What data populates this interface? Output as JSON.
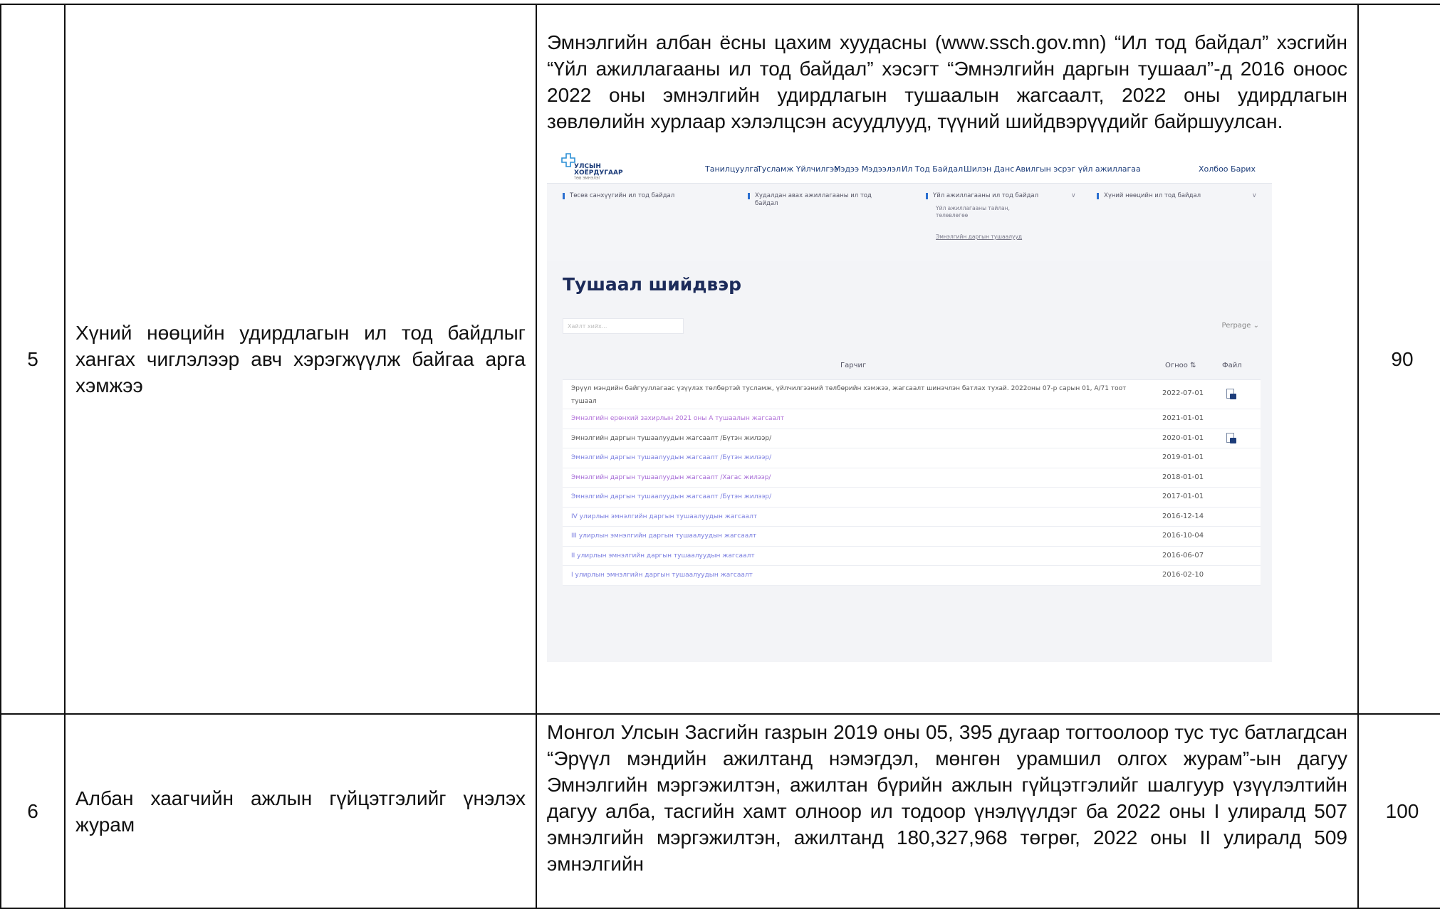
{
  "rows": [
    {
      "num": "5",
      "title": "Хүний нөөцийн удирдлагын ил тод байдлыг хангах чиглэлээр авч хэрэгжүүлж байгаа арга хэмжээ",
      "description": "Эмнэлгийн албан ёсны цахим хуудасны (www.ssch.gov.mn) “Ил тод байдал” хэсгийн “Үйл ажиллагааны ил тод байдал” хэсэгт “Эмнэлгийн даргын тушаал”-д 2016 оноос 2022 оны эмнэлгийн удирдлагын тушаалын жагсаалт, 2022 оны удирдлагын зөвлөлийн хурлаар хэлэлцсэн асуудлууд, түүний шийдвэрүүдийг байршуулсан.",
      "score": "90"
    },
    {
      "num": "6",
      "title": "Албан хаагчийн ажлын гүйцэтгэлийг үнэлэх журам",
      "description": "Монгол Улсын Засгийн газрын 2019 оны 05, 395 дугаар тогтоолоор тус тус батлагдсан “Эрүүл мэндийн ажилтанд нэмэгдэл, мөнгөн урамшил олгох журам”-ын дагуу Эмнэлгийн мэргэжилтэн, ажилтан бүрийн ажлын гүйцэтгэлийг шалгуур үзүүлэлтийн дагуу алба, тасгийн хамт олноор ил тодоор үнэлүүлдэг ба 2022 оны I улиралд 507 эмнэлгийн мэргэжилтэн, ажилтанд 180,327,968 төгрөг, 2022 оны II улиралд 509 эмнэлгийн",
      "score": "100"
    }
  ],
  "screenshot": {
    "logo": {
      "line1": "УЛСЫН",
      "line2": "ХОЁРДУГААР",
      "line3": "ТӨВ ЭМНЭЛЭГ"
    },
    "nav": [
      "Танилцуулга",
      "Тусламж Үйлчилгээ",
      "Мэдээ Мэдээлэл",
      "Ил Тод Байдал",
      "Шилэн Данс",
      "Авилгын эсрэг үйл ажиллагаа",
      "Холбоо Барих"
    ],
    "subnav": {
      "item1": "Төсөв санхүүгийн ил тод байдал",
      "item2": "Худалдан авах ажиллагааны ил тод байдал",
      "item3": "Үйл ажиллагааны ил тод байдал",
      "item3_sub1": "Үйл ажиллагааны тайлан, төлөвлөгөө",
      "item3_sub2": "Эмнэлгийн даргын тушаалууд",
      "item4": "Хүний нөөцийн ил тод байдал",
      "chevron": "∨"
    },
    "page_title": "Тушаал шийдвэр",
    "search_placeholder": "Хайлт хийх...",
    "perpage": "Perpage  ⌄",
    "columns": {
      "title": "Гарчиг",
      "date": "Огноо ⇅",
      "file": "Файл"
    },
    "items": [
      {
        "title": "Эрүүл мэндийн байгууллагаас үзүүлэх төлбөртэй тусламж, үйлчилгээний төлбөрийн хэмжээ, жагсаалт шинэчлэн батлах тухай. 2022оны 07-р сарын 01, А/71 тоот тушаал",
        "date": "2022-07-01",
        "color": "#555555"
      },
      {
        "title": "Эмнэлгийн ерөнхий захирлын 2021 оны А тушаалын жагсаалт",
        "date": "2021-01-01",
        "color": "#b06fd8"
      },
      {
        "title": "Эмнэлгийн даргын тушаалуудын жагсаалт /Бүтэн жилээр/",
        "date": "2020-01-01",
        "color": "#555555"
      },
      {
        "title": "Эмнэлгийн даргын тушаалуудын жагсаалт /Бүтэн жилээр/",
        "date": "2019-01-01",
        "color": "#7a7ee0"
      },
      {
        "title": "Эмнэлгийн даргын тушаалуудын жагсаалт /Хагас жилээр/",
        "date": "2018-01-01",
        "color": "#a56ad6"
      },
      {
        "title": "Эмнэлгийн даргын тушаалуудын жагсаалт /Бүтэн жилээр/",
        "date": "2017-01-01",
        "color": "#7a7ee0"
      },
      {
        "title": "IV улирлын эмнэлгийн даргын тушаалуудын жагсаалт",
        "date": "2016-12-14",
        "color": "#7a7ee0"
      },
      {
        "title": "III улирлын эмнэлгийн даргын тушаалуудын жагсаалт",
        "date": "2016-10-04",
        "color": "#7a7ee0"
      },
      {
        "title": "II улирлын эмнэлгийн даргын тушаалуудын жагсаалт",
        "date": "2016-06-07",
        "color": "#7a7ee0"
      },
      {
        "title": "I улирлын эмнэлгийн даргын тушаалуудын жагсаалт",
        "date": "2016-02-10",
        "color": "#7a7ee0"
      }
    ],
    "file_icon_rows": [
      0,
      2
    ]
  }
}
